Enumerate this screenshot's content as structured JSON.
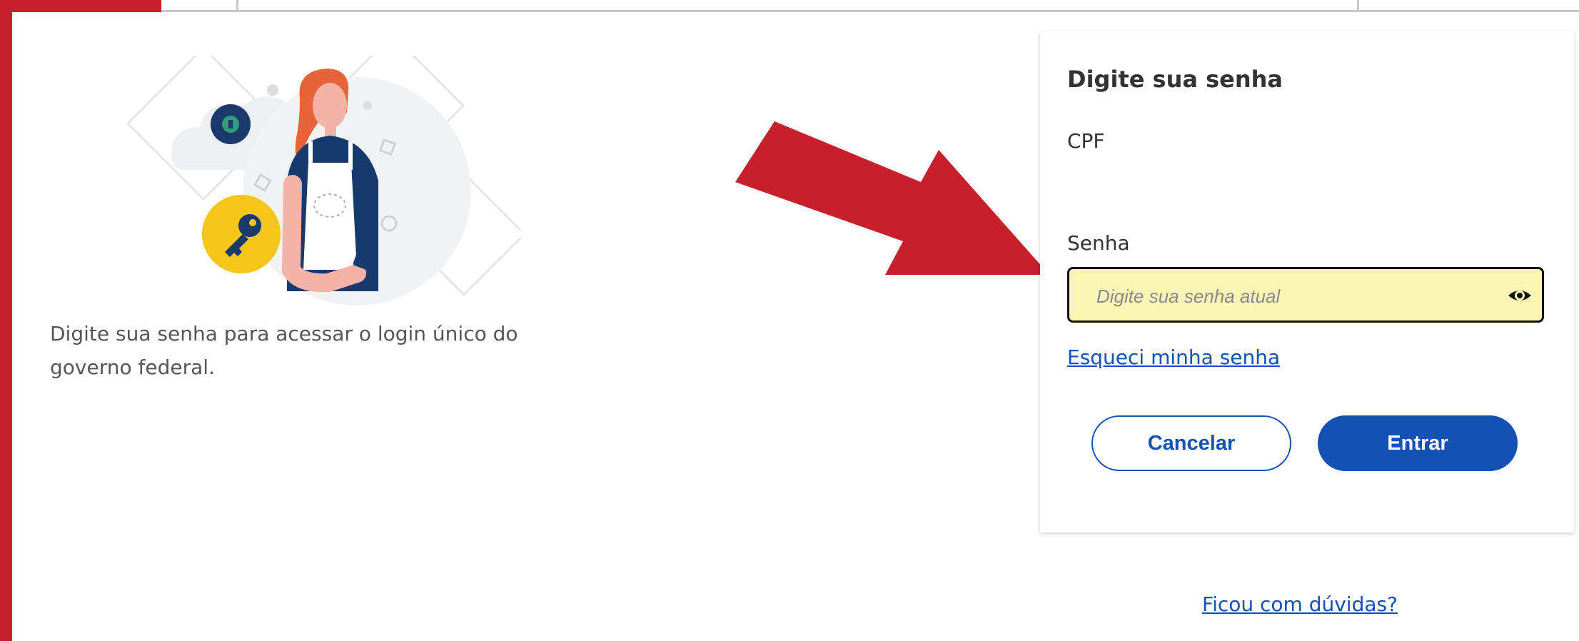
{
  "intro": {
    "text_line1": "Digite sua senha para acessar o login único do",
    "text_line2": "governo federal."
  },
  "login_card": {
    "title": "Digite sua senha",
    "cpf_label": "CPF",
    "password_label": "Senha",
    "password_placeholder": "Digite sua senha atual",
    "password_value": "",
    "show_password_icon": "eye-icon",
    "forgot_password_link": "Esqueci minha senha",
    "cancel_button": "Cancelar",
    "enter_button": "Entrar"
  },
  "footer": {
    "help_link": "Ficou com dúvidas?"
  },
  "colors": {
    "primary_blue": "#1351b4",
    "accent_red": "#c8202a",
    "input_highlight": "#fbf5b5"
  }
}
